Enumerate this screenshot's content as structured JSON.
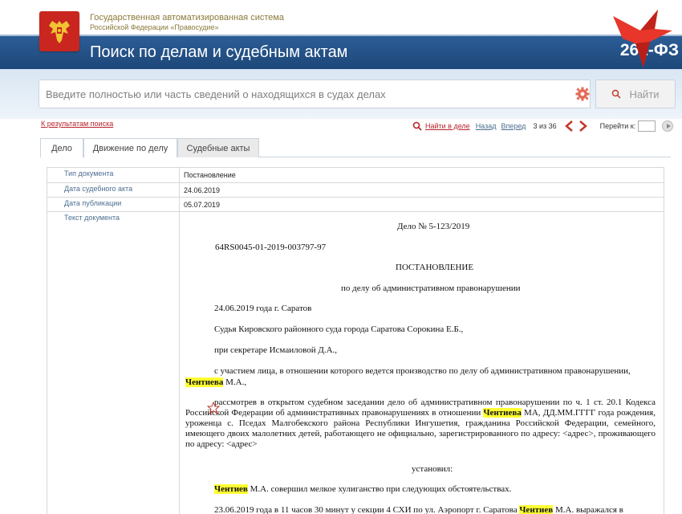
{
  "header": {
    "system_title": "Государственная автоматизированная система",
    "system_subtitle": "Российской Федерации «Правосудие»",
    "page_title": "Поиск по делам и судебным актам",
    "law_badge": "262-ФЗ"
  },
  "search": {
    "placeholder": "Введите полностью или часть сведений о находящихся в судах делах",
    "find_label": "Найти"
  },
  "nav": {
    "back_to_results": "К результатам поиска",
    "find_in_case": "Найти в деле",
    "back": "Назад",
    "forward": "Вперед",
    "position": "3 из 36",
    "goto_label": "Перейти к:"
  },
  "tabs": [
    {
      "label": "Дело"
    },
    {
      "label": "Движение по делу"
    },
    {
      "label": "Судебные акты",
      "active": true
    }
  ],
  "meta": {
    "doc_type_label": "Тип документа",
    "doc_type_value": "Постановление",
    "act_date_label": "Дата судебного акта",
    "act_date_value": "24.06.2019",
    "pub_date_label": "Дата публикации",
    "pub_date_value": "05.07.2019",
    "text_label": "Текст документа"
  },
  "document": {
    "case_no": "Дело № 5-123/2019",
    "uid": "64RS0045-01-2019-003797-97",
    "title": "ПОСТАНОВЛЕНИЕ",
    "subtitle": "по делу об административном правонарушении",
    "date_place": "24.06.2019 года г. Саратов",
    "judge": "Судья Кировского районного суда города Саратова Сорокина Е.Б.,",
    "secretary": "при секретаре Исмаиловой Д.А.,",
    "participant_a": "с участием лица, в отношении которого ведется производство по делу об административном правонарушении,",
    "name_hl": "Чентиева",
    "participant_b": " М.А.,",
    "p1_a": "рассмотрев в открытом судебном заседании дело об административном правонарушении по ч. 1 ст. 20.1 Кодекса Российской Федерации об административных правонарушениях в отношении ",
    "p1_name": "Чентиева",
    "p1_b": " МА, ДД.ММ.ГГГГ года рождения, уроженца с. Пседах Малгобекского района Республики Ингушетия, гражданина Российской Федерации, семейного, имеющего двоих малолетних детей, работающего не официально, зарегистрированного по адресу: <адрес>, проживающего по адресу: <адрес>",
    "established": "установил:",
    "p2_name": "Чентиев",
    "p2_text": " М.А. совершил мелкое хулиганство при следующих обстоятельствах.",
    "p3_a": "23.06.2019 года в 11 часов 30 минут у секции 4 СХИ по ул. Аэропорт г. Саратова ",
    "p3_name": "Чентиев",
    "p3_b": " М.А. выражался в"
  }
}
